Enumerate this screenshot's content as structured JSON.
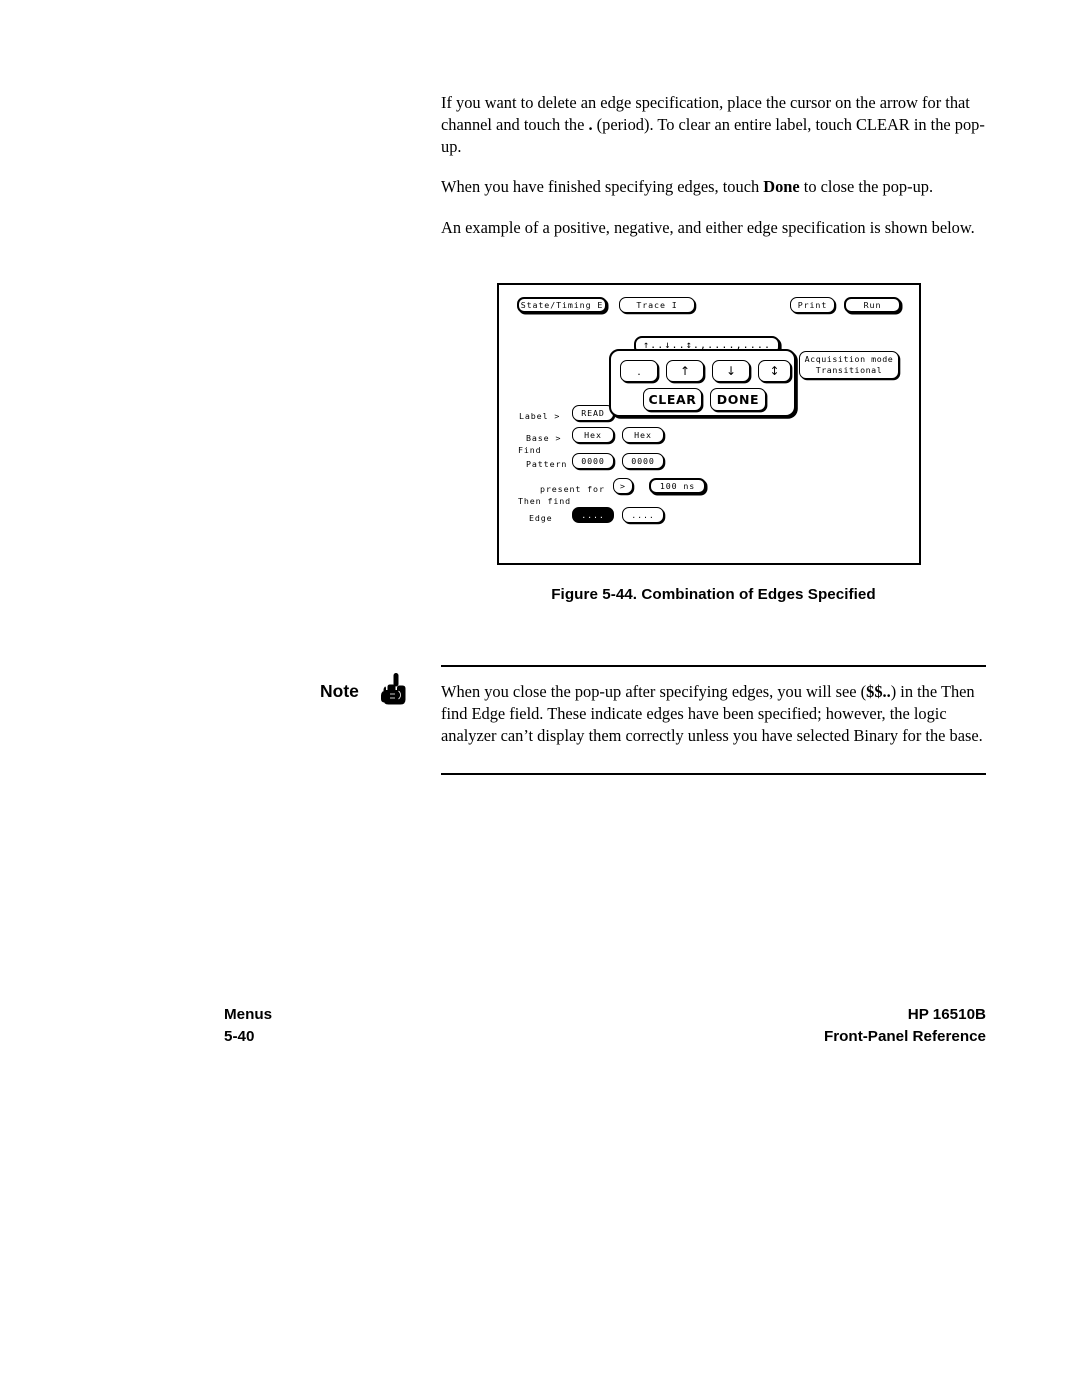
{
  "body_paragraphs": [
    {
      "id": "p1",
      "parts": [
        {
          "t": "If you want to delete an edge specification, place the cursor on the arrow for that channel and touch the ",
          "b": false
        },
        {
          "t": ".",
          "b": true
        },
        {
          "t": " (period). To clear an entire label, touch CLEAR in the pop-up.",
          "b": false
        }
      ]
    },
    {
      "id": "p2",
      "parts": [
        {
          "t": "When you have finished specifying edges, touch ",
          "b": false
        },
        {
          "t": "Done",
          "b": true
        },
        {
          "t": " to close the pop-up.",
          "b": false
        }
      ]
    },
    {
      "id": "p3",
      "parts": [
        {
          "t": "An example of a positive, negative, and either edge specification is shown below.",
          "b": false
        }
      ]
    }
  ],
  "figure": {
    "caption": "Figure 5-44. Combination of Edges Specified",
    "screen": {
      "menu_keys": [
        {
          "name": "state-timing-key",
          "label": "State/Timing E"
        },
        {
          "name": "trace-key",
          "label": "Trace I"
        },
        {
          "name": "print-key",
          "label": "Print"
        },
        {
          "name": "run-key",
          "label": "Run"
        }
      ],
      "edge_readout": "↑..↓..↕.,....,....",
      "acquisition": {
        "title": "Acquisition mode",
        "value": "Transitional"
      },
      "popup": {
        "period_key": ".",
        "rising_key": "↑",
        "falling_key": "↓",
        "either_key": "↕",
        "clear_key": "CLEAR",
        "done_key": "DONE"
      },
      "fields": {
        "label_caption": "Label >",
        "label_value": "READ",
        "base_caption": "Base >",
        "base_value_1": "Hex",
        "base_value_2": "Hex",
        "find_caption": "Find",
        "pattern_caption": "Pattern",
        "pattern_value_1": "0000",
        "pattern_value_2": "0000",
        "present_for_caption": "present for",
        "present_for_op": ">",
        "present_for_time": "100 ns",
        "then_find_caption": "Then find",
        "edge_caption": "Edge",
        "edge_value_1": "....",
        "edge_value_2": "...."
      }
    }
  },
  "note": {
    "word": "Note",
    "icon": "pointing-hand-icon",
    "parts": [
      {
        "t": "When you close the pop-up after specifying edges, you will see (",
        "b": false
      },
      {
        "t": "$$..",
        "b": true
      },
      {
        "t": ") in the Then find Edge field. These indicate edges have been specified; however, the logic analyzer can’t display them correctly unless you have selected Binary for the base.",
        "b": false
      }
    ]
  },
  "footer": {
    "left_line1": "Menus",
    "left_line2": "5-40",
    "right_line1": "HP 16510B",
    "right_line2": "Front-Panel Reference"
  }
}
